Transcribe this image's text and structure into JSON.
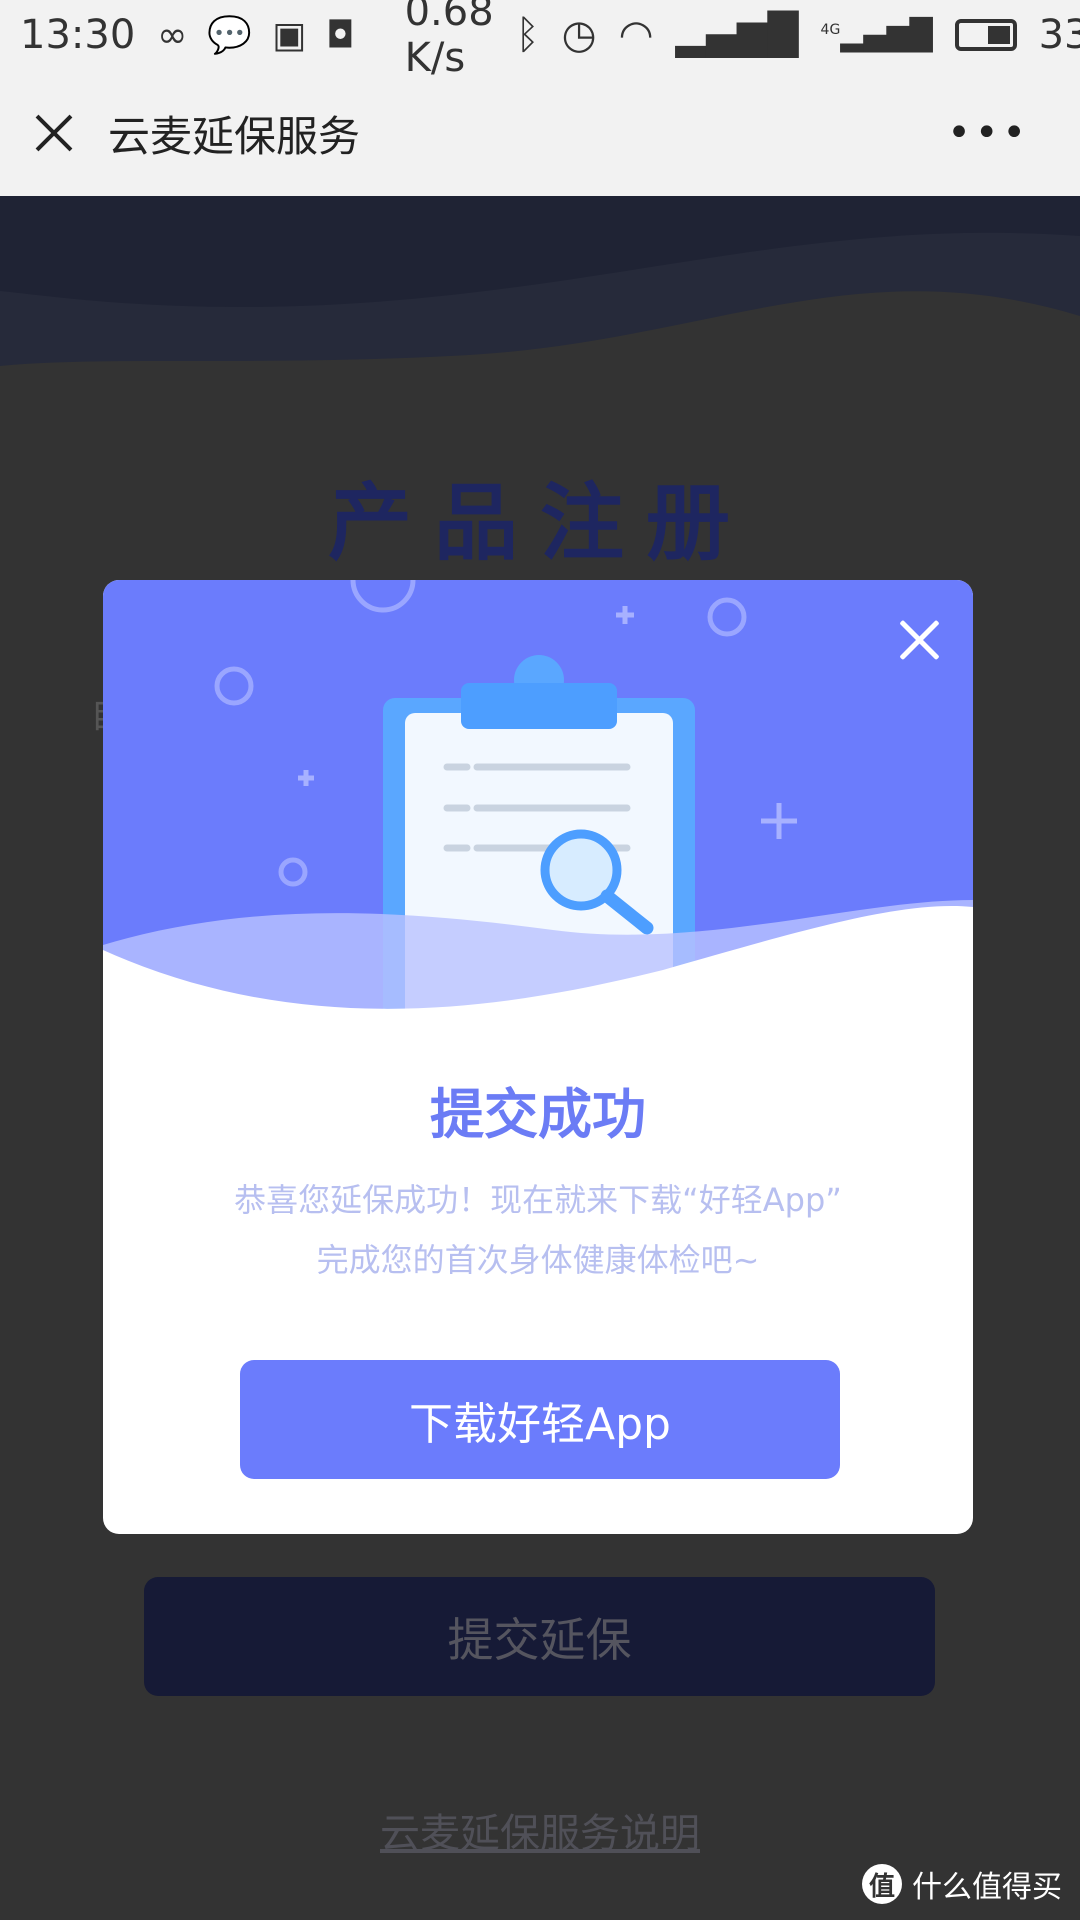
{
  "status_bar": {
    "time": "13:30",
    "net_speed": "0.68 K/s",
    "network": "4G",
    "battery": "33",
    "icons": [
      "infinity-icon",
      "chat-bubble-icon",
      "gallery-icon",
      "qq-icon",
      "bluetooth-icon",
      "alarm-icon",
      "wifi-icon",
      "signal-icon",
      "signal-4g-icon",
      "battery-icon"
    ]
  },
  "nav": {
    "title": "云麦延保服务",
    "more": "•••"
  },
  "page": {
    "title": "产品注册",
    "side_char": "自",
    "submit_label": "提交延保",
    "service_link": "云麦延保服务说明"
  },
  "modal": {
    "title": "提交成功",
    "message_line1": "恭喜您延保成功！现在就来下载“好轻App”",
    "message_line2": "完成您的首次身体健康体检吧~",
    "download_label": "下载好轻App"
  },
  "watermark": {
    "logo": "值",
    "text": "什么值得买"
  },
  "colors": {
    "accent": "#6b7cfc",
    "title": "#6b7cf5",
    "text": "#b7bff0",
    "brand_dark": "#1c2a6b"
  }
}
